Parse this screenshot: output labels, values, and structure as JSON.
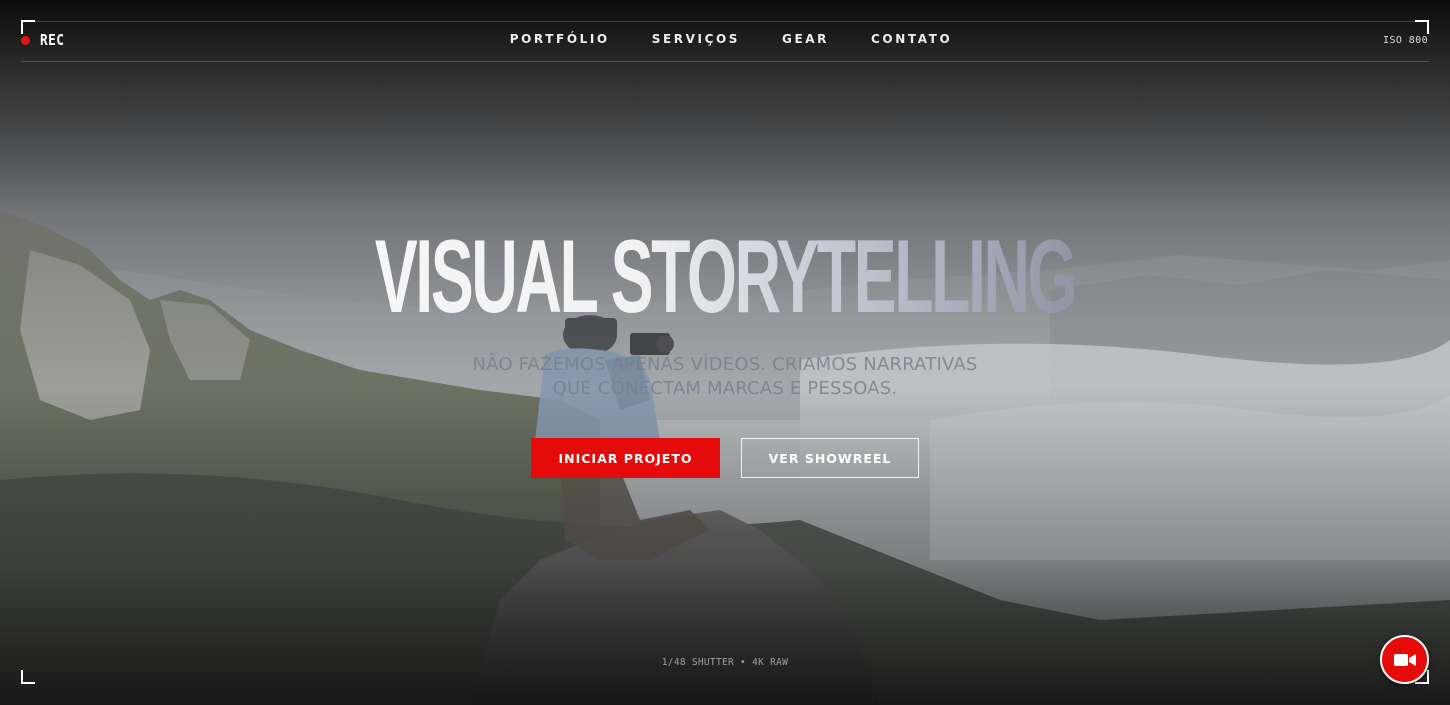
{
  "header": {
    "rec_label": "REC",
    "iso_label": "ISO 800",
    "nav": [
      {
        "label": "PORTFÓLIO"
      },
      {
        "label": "SERVIÇOS"
      },
      {
        "label": "GEAR"
      },
      {
        "label": "CONTATO"
      }
    ]
  },
  "hero": {
    "headline": "VISUAL STORYTELLING",
    "tagline_line1": "NÃO FAZEMOS APENAS VÍDEOS. CRIAMOS NARRATIVAS",
    "tagline_line2": "QUE CONECTAM MARCAS E PESSOAS.",
    "primary_button": "INICIAR PROJETO",
    "secondary_button": "VER SHOWREEL"
  },
  "footer": {
    "camera_info": "1/48 SHUTTER • 4K RAW"
  },
  "colors": {
    "accent": "#e50b0b",
    "rec_dot": "#e01414"
  },
  "icons": {
    "fab": "video-camera-icon"
  }
}
